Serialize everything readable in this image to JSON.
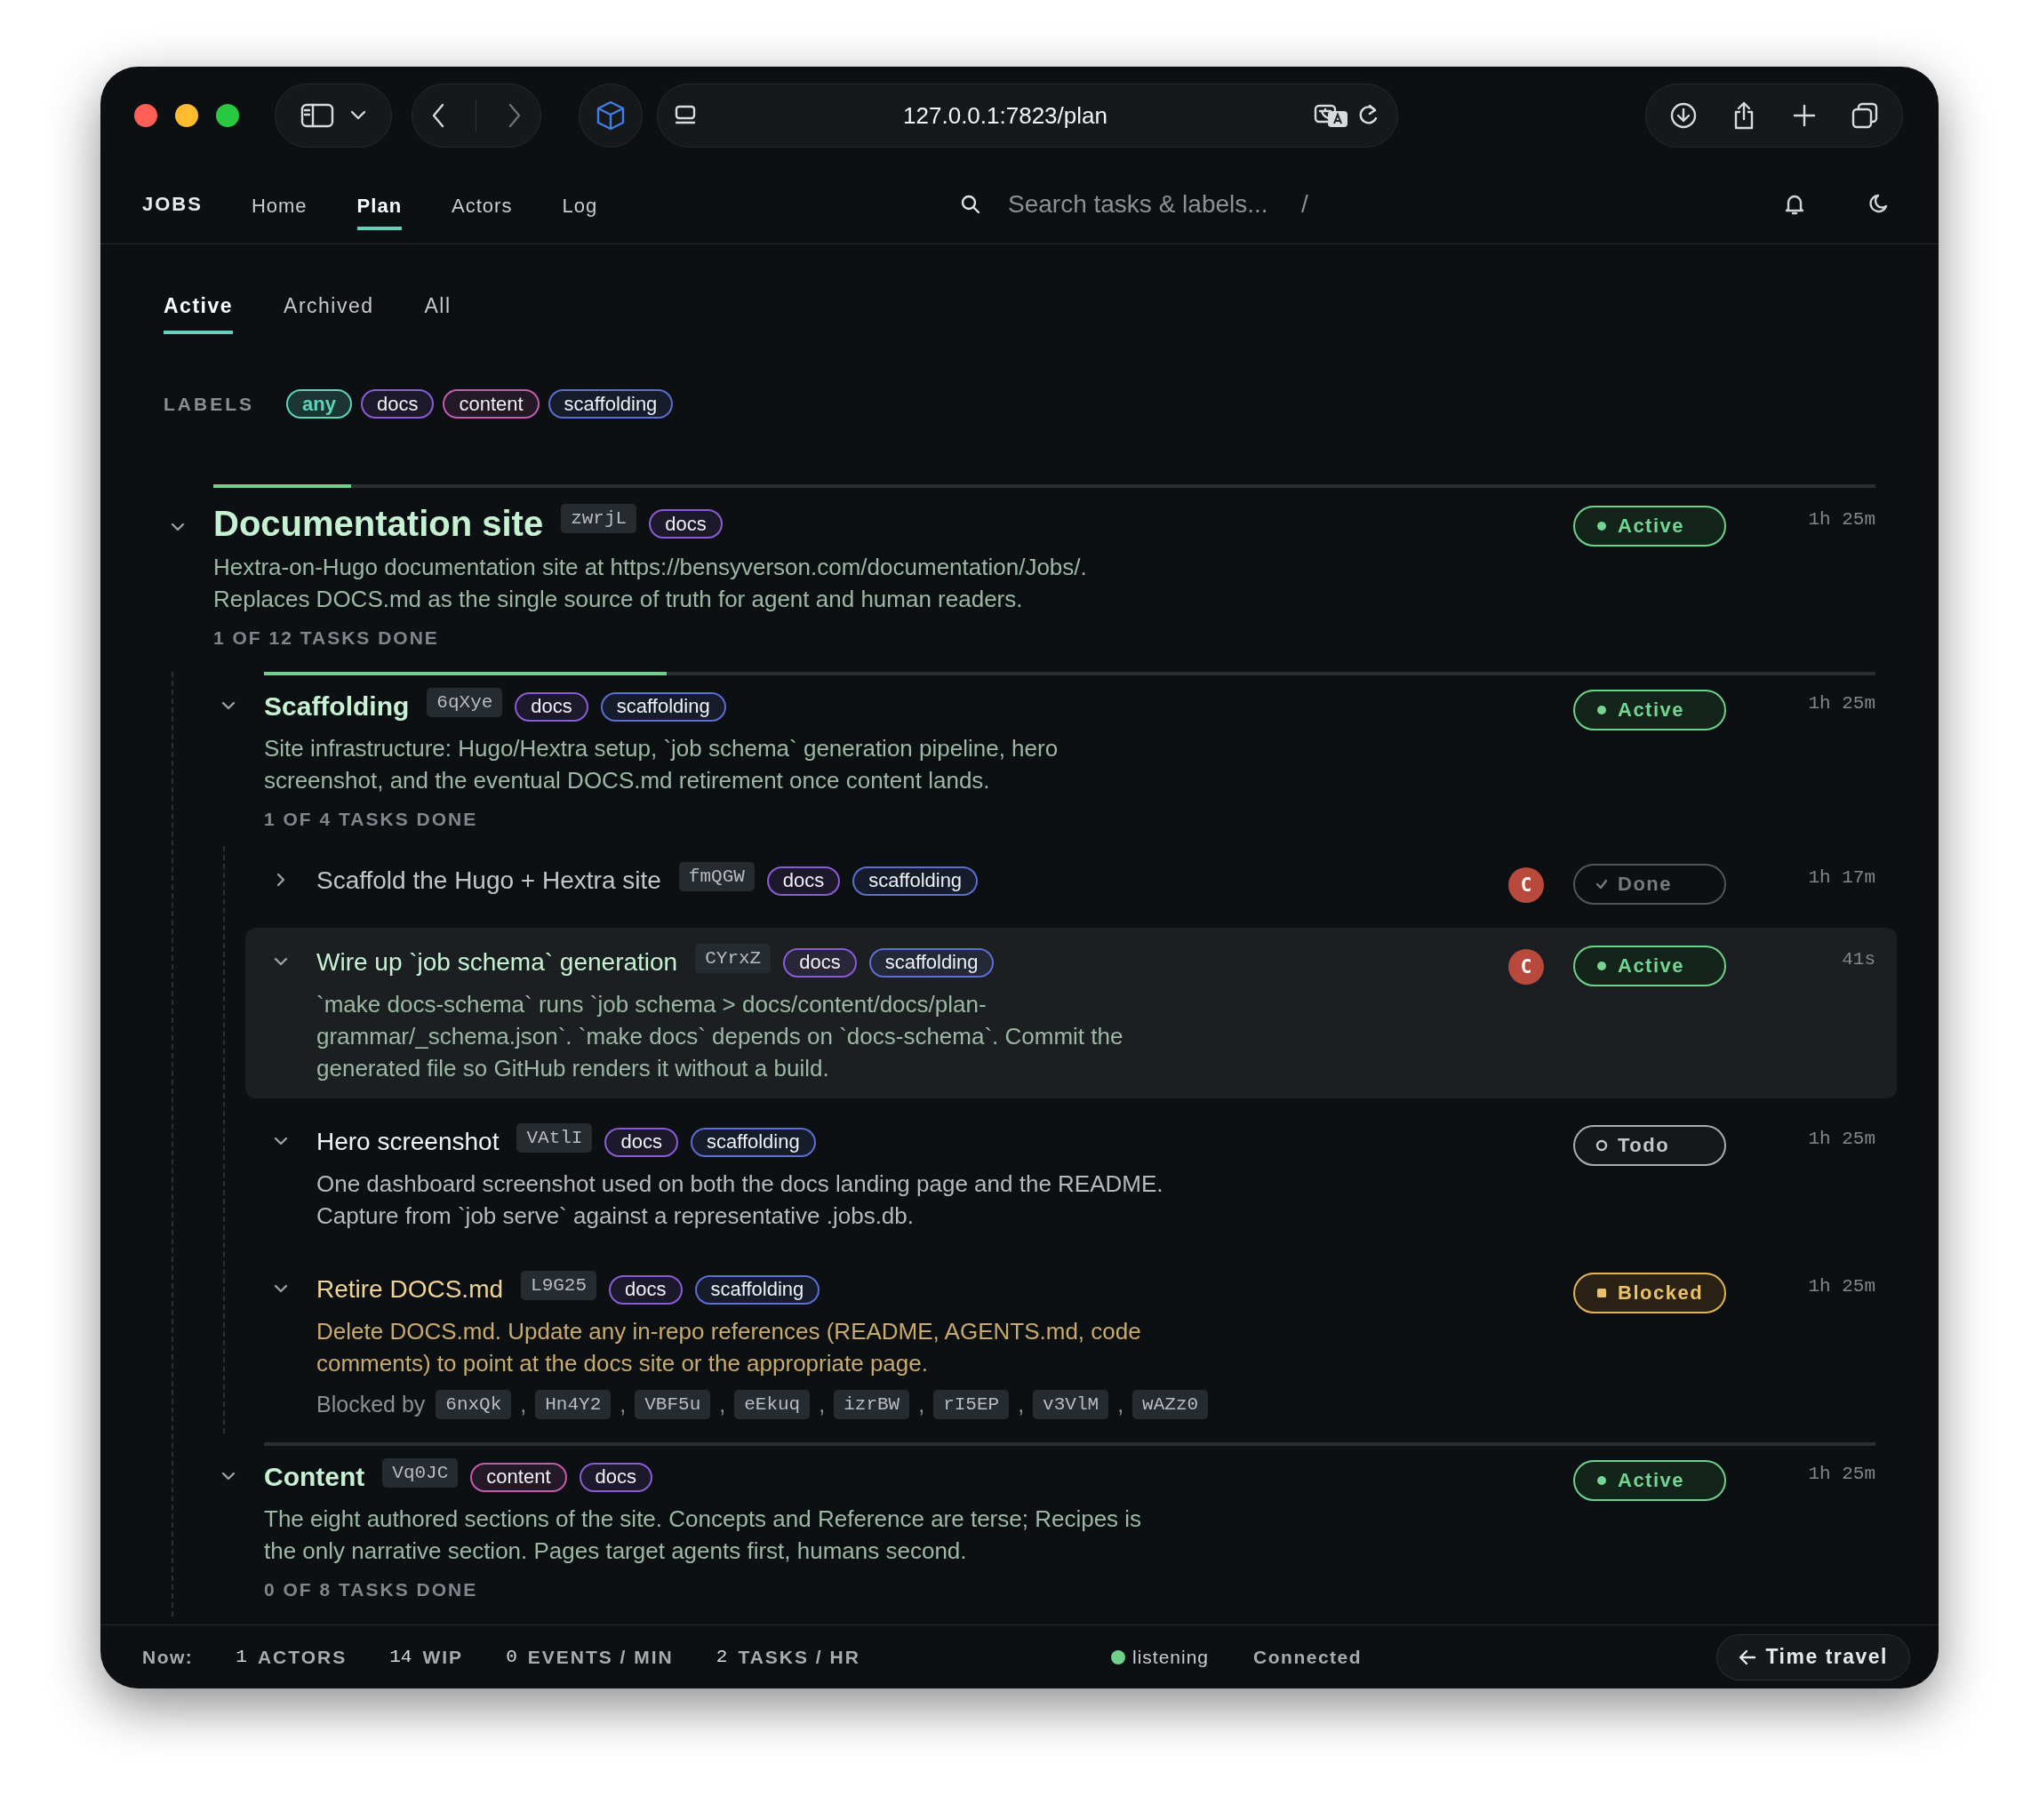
{
  "browser": {
    "url": "127.0.0.1:7823/plan"
  },
  "nav": {
    "brand": "JOBS",
    "items": [
      {
        "label": "Home",
        "selected": false
      },
      {
        "label": "Plan",
        "selected": true
      },
      {
        "label": "Actors",
        "selected": false
      },
      {
        "label": "Log",
        "selected": false
      }
    ],
    "search": {
      "placeholder": "Search tasks & labels...",
      "shortcut": "/"
    }
  },
  "view_tabs": [
    {
      "label": "Active",
      "selected": true
    },
    {
      "label": "Archived",
      "selected": false
    },
    {
      "label": "All",
      "selected": false
    }
  ],
  "label_filter": {
    "heading": "LABELS",
    "options": [
      {
        "label": "any",
        "selected": true,
        "color": "#5fd3bc"
      },
      {
        "label": "docs",
        "selected": false,
        "color": "#8b5cd6"
      },
      {
        "label": "content",
        "selected": false,
        "color": "#c45bb0"
      },
      {
        "label": "scaffolding",
        "selected": false,
        "color": "#5a6fd0"
      }
    ]
  },
  "plan": [
    {
      "kind": "epic",
      "title": "Documentation site",
      "id": "zwrjL",
      "labels": [
        {
          "name": "docs",
          "color": "#8b5cd6"
        }
      ],
      "description": "Hextra-on-Hugo documentation site at https://bensyverson.com/documentation/Jobs/. Replaces DOCS.md as the single source of truth for agent and human readers.",
      "progress": "1 OF 12 TASKS DONE",
      "level": 0.083,
      "status": {
        "kind": "active",
        "label": "Active"
      },
      "age": "1h 25m",
      "expanded": true,
      "selected": false,
      "children": [
        {
          "kind": "group",
          "title": "Scaffolding",
          "id": "6qXye",
          "labels": [
            {
              "name": "docs",
              "color": "#8b5cd6"
            },
            {
              "name": "scaffolding",
              "color": "#5a6fd0"
            }
          ],
          "description": "Site infrastructure: Hugo/Hextra setup, `job schema` generation pipeline, hero screenshot, and the eventual DOCS.md retirement once content lands.",
          "progress": "1 OF 4 TASKS DONE",
          "level": 0.25,
          "status": {
            "kind": "active",
            "label": "Active"
          },
          "age": "1h 25m",
          "expanded": true,
          "selected": false,
          "children": [
            {
              "kind": "task",
              "title": "Scaffold the Hugo + Hextra site",
              "id": "fmQGW",
              "labels": [
                {
                  "name": "docs",
                  "color": "#8b5cd6"
                },
                {
                  "name": "scaffolding",
                  "color": "#5a6fd0"
                }
              ],
              "assignee": "C",
              "status": {
                "kind": "done",
                "label": "Done"
              },
              "age": "1h 17m",
              "expanded": false,
              "selected": false
            },
            {
              "kind": "task",
              "title": "Wire up `job schema` generation",
              "id": "CYrxZ",
              "labels": [
                {
                  "name": "docs",
                  "color": "#8b5cd6"
                },
                {
                  "name": "scaffolding",
                  "color": "#5a6fd0"
                }
              ],
              "description": "`make docs-schema` runs `job schema > docs/content/docs/plan-grammar/_schema.json`. `make docs` depends on `docs-schema`. Commit the generated file so GitHub renders it without a build.",
              "assignee": "C",
              "status": {
                "kind": "active",
                "label": "Active"
              },
              "age": "41s",
              "expanded": true,
              "selected": true
            },
            {
              "kind": "task",
              "title": "Hero screenshot",
              "id": "VAtlI",
              "labels": [
                {
                  "name": "docs",
                  "color": "#8b5cd6"
                },
                {
                  "name": "scaffolding",
                  "color": "#5a6fd0"
                }
              ],
              "description": "One dashboard screenshot used on both the docs landing page and the README. Capture from `job serve` against a representative .jobs.db.",
              "status": {
                "kind": "todo",
                "label": "Todo"
              },
              "age": "1h 25m",
              "expanded": true,
              "selected": false
            },
            {
              "kind": "task",
              "title": "Retire DOCS.md",
              "id": "L9G25",
              "labels": [
                {
                  "name": "docs",
                  "color": "#8b5cd6"
                },
                {
                  "name": "scaffolding",
                  "color": "#5a6fd0"
                }
              ],
              "description": "Delete DOCS.md. Update any in-repo references (README, AGENTS.md, code comments) to point at the docs site or the appropriate page.",
              "blocked_by": {
                "label": "Blocked by",
                "separator": ",",
                "ids": [
                  "6nxQk",
                  "Hn4Y2",
                  "VBF5u",
                  "eEkuq",
                  "izrBW",
                  "rI5EP",
                  "v3VlM",
                  "wAZz0"
                ]
              },
              "status": {
                "kind": "blocked",
                "label": "Blocked"
              },
              "age": "1h 25m",
              "expanded": true,
              "selected": false
            }
          ]
        },
        {
          "kind": "group",
          "title": "Content",
          "id": "Vq0JC",
          "labels": [
            {
              "name": "content",
              "color": "#c45bb0"
            },
            {
              "name": "docs",
              "color": "#8b5cd6"
            }
          ],
          "description": "The eight authored sections of the site. Concepts and Reference are terse; Recipes is the only narrative section. Pages target agents first, humans second.",
          "progress": "0 OF 8 TASKS DONE",
          "level": 0,
          "status": {
            "kind": "active",
            "label": "Active"
          },
          "age": "1h 25m",
          "expanded": true,
          "selected": false
        }
      ]
    }
  ],
  "status_bar": {
    "prefix": "Now:",
    "stats": [
      {
        "value": "1",
        "label": "ACTORS"
      },
      {
        "value": "14",
        "label": "WIP"
      },
      {
        "value": "0",
        "label": "EVENTS / MIN"
      },
      {
        "value": "2",
        "label": "TASKS / HR"
      }
    ],
    "listener": {
      "label": "listening",
      "on": true
    },
    "connection": "Connected",
    "button": "Time travel"
  }
}
